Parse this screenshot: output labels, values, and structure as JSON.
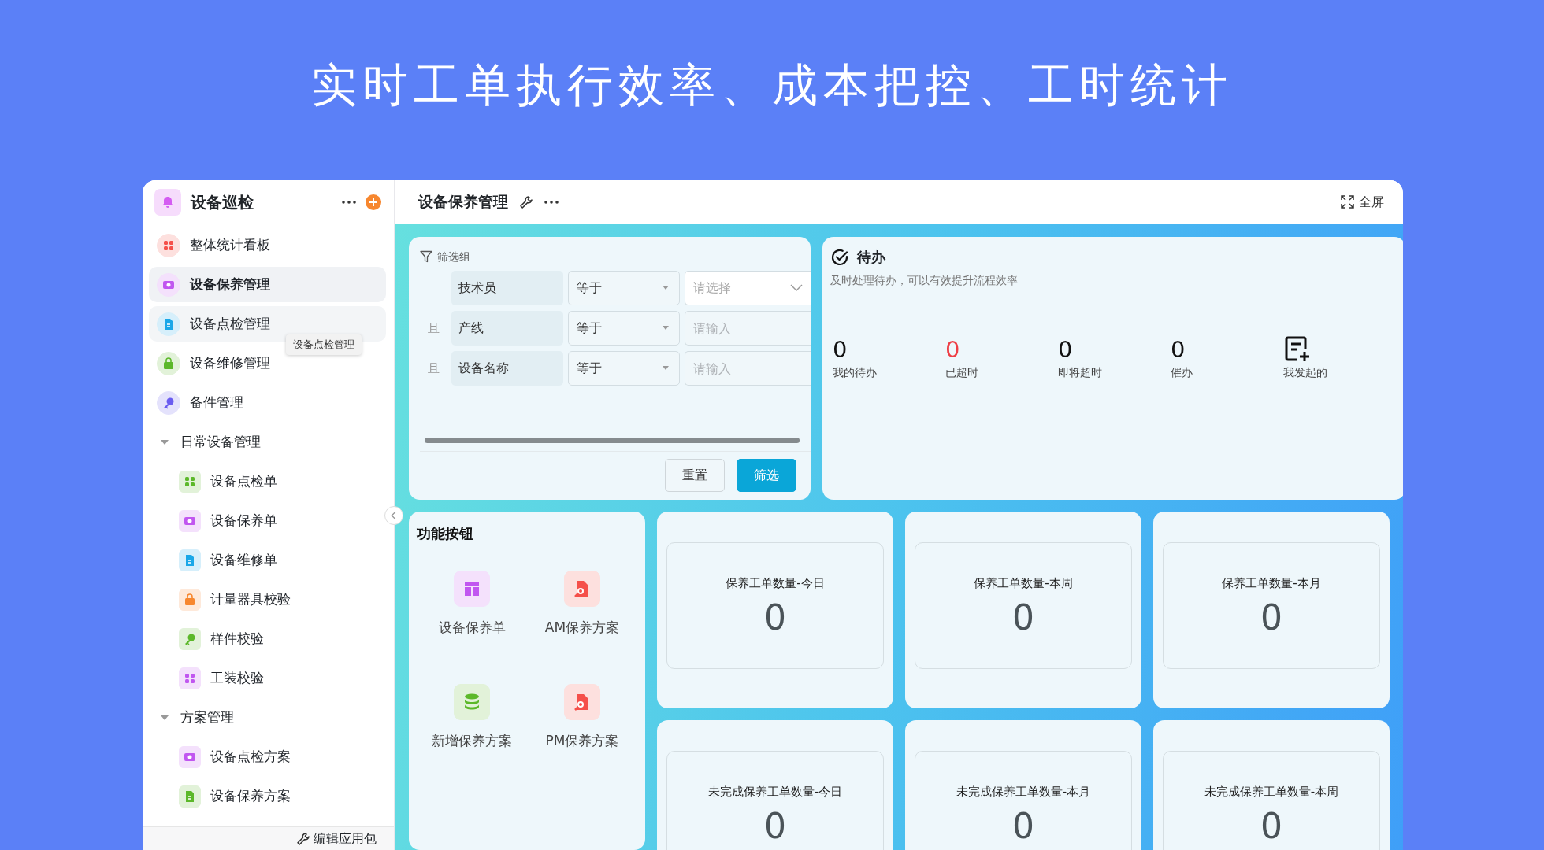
{
  "headline": "实时工单执行效率、成本把控、工时统计",
  "sidebar": {
    "app_title": "设备巡检",
    "items": [
      {
        "label": "整体统计看板",
        "kind": "item",
        "selected": false,
        "hovered": false,
        "color": "#f5504a"
      },
      {
        "label": "设备保养管理",
        "kind": "item",
        "selected": true,
        "hovered": false,
        "color": "#c156f0"
      },
      {
        "label": "设备点检管理",
        "kind": "item",
        "selected": false,
        "hovered": true,
        "color": "#1aa7e8"
      },
      {
        "label": "设备维修管理",
        "kind": "item",
        "selected": false,
        "hovered": false,
        "color": "#5cb82a"
      },
      {
        "label": "备件管理",
        "kind": "item",
        "selected": false,
        "hovered": false,
        "color": "#6a5cf0"
      },
      {
        "label": "日常设备管理",
        "kind": "group",
        "expanded": true,
        "selected": false,
        "children": [
          {
            "label": "设备点检单",
            "kind": "item",
            "selected": false,
            "hovered": false,
            "color": "#5cb82a"
          },
          {
            "label": "设备保养单",
            "kind": "item",
            "selected": false,
            "hovered": false,
            "color": "#c156f0"
          },
          {
            "label": "设备维修单",
            "kind": "item",
            "selected": false,
            "hovered": false,
            "color": "#1aa7e8"
          },
          {
            "label": "计量器具校验",
            "kind": "item",
            "selected": false,
            "hovered": false,
            "color": "#f7872f"
          },
          {
            "label": "样件校验",
            "kind": "item",
            "selected": false,
            "hovered": false,
            "color": "#5cb82a"
          },
          {
            "label": "工装校验",
            "kind": "item",
            "selected": false,
            "hovered": false,
            "color": "#c156f0"
          }
        ]
      },
      {
        "label": "方案管理",
        "kind": "group",
        "expanded": true,
        "selected": false,
        "children": [
          {
            "label": "设备点检方案",
            "kind": "item",
            "selected": false,
            "hovered": false,
            "color": "#c156f0"
          },
          {
            "label": "设备保养方案",
            "kind": "item",
            "selected": false,
            "hovered": false,
            "color": "#5cb82a"
          }
        ]
      }
    ],
    "tooltip": "设备点检管理",
    "footer": "编辑应用包"
  },
  "topbar": {
    "title": "设备保养管理",
    "fullscreen": "全屏"
  },
  "filter": {
    "title": "筛选组",
    "rows": [
      {
        "field": "技术员",
        "operator": "等于",
        "placeholder": "请选择",
        "kind": "select"
      },
      {
        "joiner": "且",
        "field": "产线",
        "operator": "等于",
        "placeholder": "请输入",
        "kind": "input"
      },
      {
        "joiner": "且",
        "field": "设备名称",
        "operator": "等于",
        "placeholder": "请输入",
        "kind": "input"
      }
    ],
    "buttons": [
      {
        "label": "重置",
        "primary": false
      },
      {
        "label": "筛选",
        "primary": true
      }
    ]
  },
  "todo": {
    "title": "待办",
    "subtitle": "及时处理待办，可以有效提升流程效率",
    "stats": [
      {
        "kind": "count",
        "value": "0",
        "label": "我的待办",
        "alert": false
      },
      {
        "kind": "count",
        "value": "0",
        "label": "已超时",
        "alert": true
      },
      {
        "kind": "count",
        "value": "0",
        "label": "即将超时",
        "alert": false
      },
      {
        "kind": "count",
        "value": "0",
        "label": "催办",
        "alert": false
      },
      {
        "kind": "icon",
        "label": "我发起的"
      }
    ]
  },
  "functions": {
    "title": "功能按钮",
    "buttons": [
      {
        "label": "设备保养单",
        "color": "#c156f0"
      },
      {
        "label": "AM保养方案",
        "color": "#f5504a"
      },
      {
        "label": "新增保养方案",
        "color": "#5cb82a"
      },
      {
        "label": "PM保养方案",
        "color": "#f5504a"
      }
    ]
  },
  "stats": [
    {
      "title": "保养工单数量-今日",
      "value": "0"
    },
    {
      "title": "保养工单数量-本周",
      "value": "0"
    },
    {
      "title": "保养工单数量-本月",
      "value": "0"
    },
    {
      "title": "未完成保养工单数量-今日",
      "value": "0"
    },
    {
      "title": "未完成保养工单数量-本月",
      "value": "0"
    },
    {
      "title": "未完成保养工单数量-本周",
      "value": "0"
    }
  ]
}
